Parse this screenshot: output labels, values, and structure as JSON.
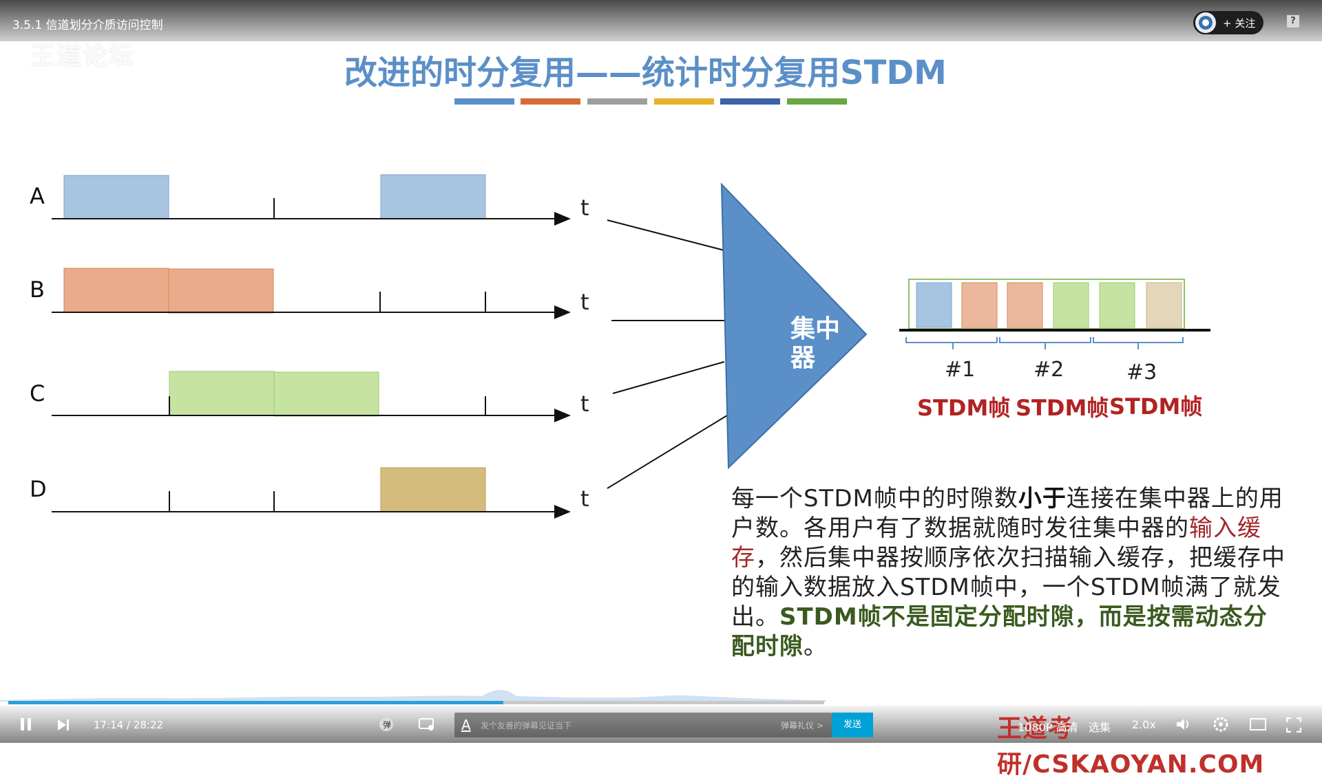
{
  "player": {
    "video_title": "3.5.1 信道划分介质访问控制",
    "follow_label": "+ 关注",
    "help_label": "?",
    "watermark_top": "王道论坛",
    "watermark_bottom": "王道考研/CSKAOYAN.COM",
    "time_current": "17:14",
    "time_total": "28:22",
    "progress": 0.607,
    "danmaku_placeholder": "发个友善的弹幕见证当下",
    "danmaku_etiquette": "弹幕礼仪 >",
    "send_label": "发送",
    "quality_label": "1080P 高清",
    "episodes_label": "选集",
    "speed_label": "2.0x",
    "accent_color": "#00a1d6"
  },
  "slide": {
    "title": "改进的时分复用——统计时分复用STDM",
    "strip_colors": [
      "#5b8fc7",
      "#d66b3a",
      "#9e9e9e",
      "#e8b22a",
      "#3e61a8",
      "#6aa641"
    ],
    "channels": [
      {
        "label": "A",
        "t": "t"
      },
      {
        "label": "B",
        "t": "t"
      },
      {
        "label": "C",
        "t": "t"
      },
      {
        "label": "D",
        "t": "t"
      }
    ],
    "concentrator_line1": "集中",
    "concentrator_line2": "器",
    "slots": [
      "#1",
      "#2",
      "#3"
    ],
    "frame_label": "STDM帧",
    "colors": {
      "A": "#a7c4e0",
      "B": "#e9ab8a",
      "C": "#c6e3a1",
      "D": "#d4bd7c",
      "D_frame": "#e5d5b9",
      "concentrator": "#5b8fc7"
    },
    "desc": {
      "p1": "每一个STDM帧中的时隙数",
      "p2": "小于",
      "p3": "连接在集中器上的用户数。各用户有了数据就随时发往集中器的",
      "p4": "输入缓存",
      "p5": "，然后集中器按顺序依次扫描输入缓存，把缓存中的输入数据放入STDM帧中，一个STDM帧满了就发出。",
      "p6": "STDM帧不是固定分配时隙，而是按需动态分配时隙",
      "p7": "。"
    }
  }
}
